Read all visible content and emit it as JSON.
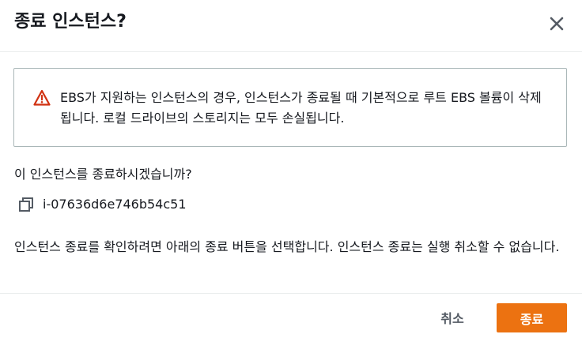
{
  "dialog": {
    "title": "종료 인스턴스?",
    "close_icon": "close-icon"
  },
  "alert": {
    "type": "warning",
    "icon": "warning-triangle-icon",
    "color": "#d13212",
    "message": "EBS가 지원하는 인스턴스의 경우, 인스턴스가 종료될 때 기본적으로 루트 EBS 볼륨이 삭제됩니다. 로컬 드라이브의 스토리지는 모두 손실됩니다."
  },
  "question": "이 인스턴스를 종료하시겠습니까?",
  "instance": {
    "copy_icon": "copy-icon",
    "id": "i-07636d6e746b54c51"
  },
  "confirm_text": "인스턴스 종료를 확인하려면 아래의 종료 버튼을 선택합니다. 인스턴스 종료는 실행 취소할 수 없습니다.",
  "footer": {
    "cancel_label": "취소",
    "terminate_label": "종료",
    "primary_color": "#ec7211"
  }
}
